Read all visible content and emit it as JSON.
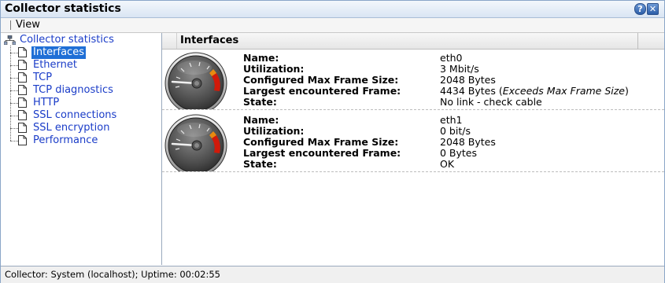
{
  "window": {
    "title": "Collector statistics",
    "help_label": "?",
    "close_label": "✕"
  },
  "menu": {
    "view_label": "View"
  },
  "tree": {
    "root_label": "Collector statistics",
    "items": [
      {
        "label": "Interfaces",
        "selected": true
      },
      {
        "label": "Ethernet"
      },
      {
        "label": "TCP"
      },
      {
        "label": "TCP diagnostics"
      },
      {
        "label": "HTTP"
      },
      {
        "label": "SSL connections"
      },
      {
        "label": "SSL encryption"
      },
      {
        "label": "Performance"
      }
    ]
  },
  "content": {
    "header": "Interfaces",
    "labels": {
      "name": "Name:",
      "utilization": "Utilization:",
      "max_frame": "Configured Max Frame Size:",
      "largest_frame": "Largest encountered Frame:",
      "state": "State:"
    },
    "interfaces": [
      {
        "name": "eth0",
        "utilization": "3 Mbit/s",
        "max_frame": "2048 Bytes",
        "largest_frame": "4434 Bytes (",
        "largest_frame_note": "Exceeds Max Frame Size",
        "largest_frame_suffix": ")",
        "state": "No link - check cable"
      },
      {
        "name": "eth1",
        "utilization": "0 bit/s",
        "max_frame": "2048 Bytes",
        "largest_frame": "0 Bytes",
        "largest_frame_note": "",
        "largest_frame_suffix": "",
        "state": "OK"
      }
    ]
  },
  "status_bar": {
    "text": "Collector: System (localhost); Uptime: 00:02:55"
  },
  "icons": {
    "help": "help-icon",
    "close": "close-icon",
    "tree_root": "network-tree-icon",
    "doc": "document-icon",
    "gauge": "gauge-icon"
  },
  "colors": {
    "link": "#1a3cc8",
    "selection": "#1f6fd6",
    "gauge_red": "#d11a0a"
  }
}
